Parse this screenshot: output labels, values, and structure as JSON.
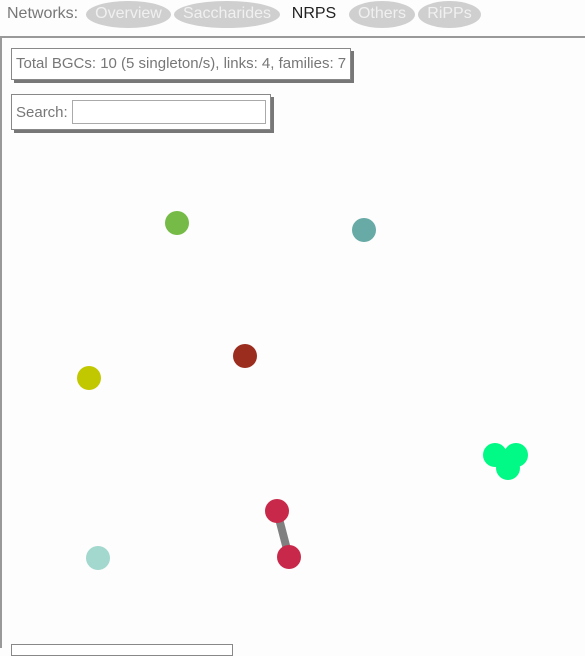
{
  "nav": {
    "label": "Networks:",
    "tabs": [
      {
        "label": "Overview",
        "active": false
      },
      {
        "label": "Saccharides",
        "active": false
      },
      {
        "label": "NRPS",
        "active": true
      },
      {
        "label": "Others",
        "active": false
      },
      {
        "label": "RiPPs",
        "active": false
      }
    ]
  },
  "info": {
    "summary": "Total BGCs: 10 (5 singleton/s), links: 4, families: 7"
  },
  "search": {
    "label": "Search:",
    "value": "",
    "placeholder": ""
  },
  "network": {
    "nodes": [
      {
        "id": "n1",
        "color": "#76bb48"
      },
      {
        "id": "n2",
        "color": "#67aaa6"
      },
      {
        "id": "n3",
        "color": "#9b2d1f"
      },
      {
        "id": "n4",
        "color": "#c2c800"
      },
      {
        "id": "n5",
        "color": "#00fa85"
      },
      {
        "id": "n6",
        "color": "#00fa85"
      },
      {
        "id": "n7",
        "color": "#00fa85"
      },
      {
        "id": "n8",
        "color": "#c8294a"
      },
      {
        "id": "n9",
        "color": "#c8294a"
      },
      {
        "id": "n10",
        "color": "#a2d8cd"
      }
    ],
    "links": [
      {
        "source": "n8",
        "target": "n9"
      },
      {
        "source": "n5",
        "target": "n6"
      },
      {
        "source": "n5",
        "target": "n7"
      },
      {
        "source": "n6",
        "target": "n7"
      }
    ],
    "link_color": "#808080"
  }
}
